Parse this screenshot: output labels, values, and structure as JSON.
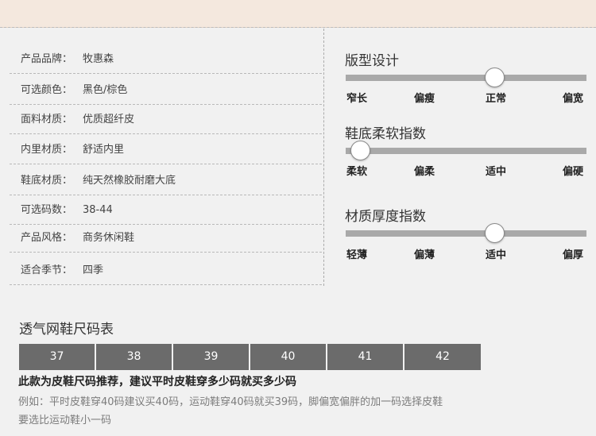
{
  "specs": [
    {
      "label": "产品品牌：",
      "value": "牧惠森"
    },
    {
      "label": "可选颜色：",
      "value": "黑色/棕色"
    },
    {
      "label": "面料材质：",
      "value": "优质超纤皮"
    },
    {
      "label": "内里材质：",
      "value": "舒适内里"
    },
    {
      "label": "鞋底材质：",
      "value": "纯天然橡胶耐磨大底"
    },
    {
      "label": "可选码数：",
      "value": "38-44"
    },
    {
      "label": "产品风格：",
      "value": "商务休闲鞋"
    },
    {
      "label": "适合季节：",
      "value": "四季"
    }
  ],
  "attributes": [
    {
      "title": "版型设计",
      "level": 0.62,
      "ticks": [
        "窄长",
        "偏瘦",
        "正常",
        "偏宽"
      ]
    },
    {
      "title": "鞋底柔软指数",
      "level": 0.06,
      "ticks": [
        "柔软",
        "偏柔",
        "适中",
        "偏硬"
      ]
    },
    {
      "title": "材质厚度指数",
      "level": 0.62,
      "ticks": [
        "轻薄",
        "偏薄",
        "适中",
        "偏厚"
      ]
    }
  ],
  "size_chart": {
    "title": "透气网鞋尺码表",
    "sizes": [
      "37",
      "38",
      "39",
      "40",
      "41",
      "42"
    ],
    "recommendation": "此款为皮鞋尺码推荐，建议平时皮鞋穿多少码就买多少码",
    "example_line1": "例如：平时皮鞋穿40码建议买40码，运动鞋穿40码就买39码，脚偏宽偏胖的加一码选择皮鞋",
    "example_line2": "要选比运动鞋小一码"
  },
  "colors": {
    "banner": "#f4e8de",
    "size_box": "#6b6b6b",
    "track": "#a9a9a9"
  }
}
